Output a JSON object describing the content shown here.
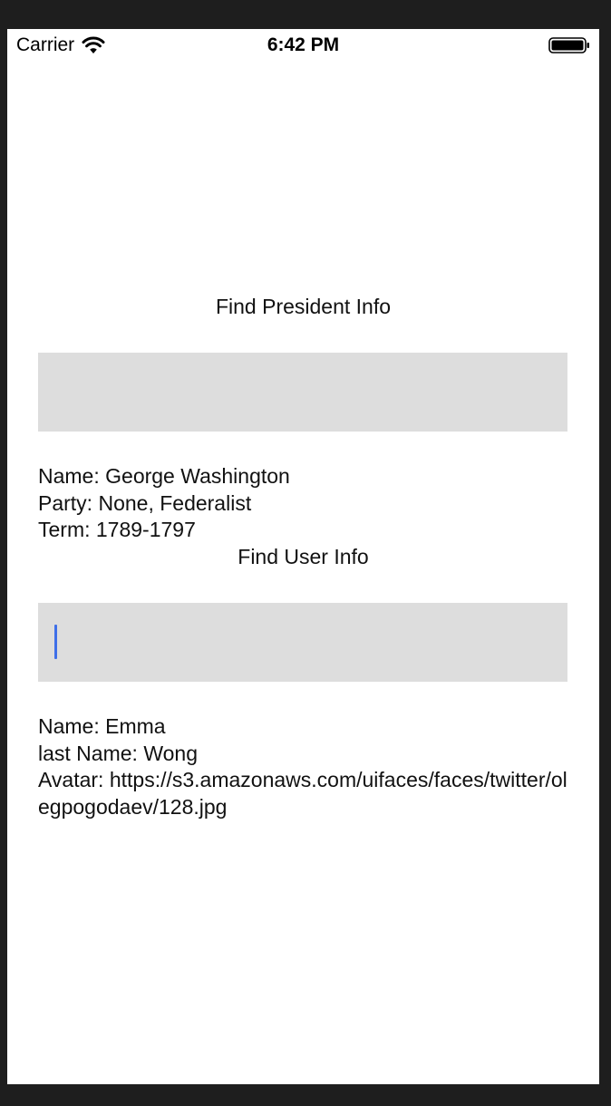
{
  "status_bar": {
    "carrier": "Carrier",
    "time": "6:42 PM",
    "wifi_icon": "wifi-icon",
    "battery_icon": "battery-icon"
  },
  "president": {
    "title": "Find President Info",
    "input_value": "",
    "name_line": "Name: George Washington",
    "party_line": "Party: None, Federalist",
    "term_line": "Term: 1789-1797"
  },
  "user": {
    "title": "Find User Info",
    "input_value": "",
    "name_line": "Name: Emma",
    "last_name_line": "last Name: Wong",
    "avatar_line": "Avatar: https://s3.amazonaws.com/uifaces/faces/twitter/olegpogodaev/128.jpg"
  },
  "colors": {
    "input_background": "#dddddd",
    "cursor": "#3f6fe8",
    "frame": "#1e1e1e"
  }
}
